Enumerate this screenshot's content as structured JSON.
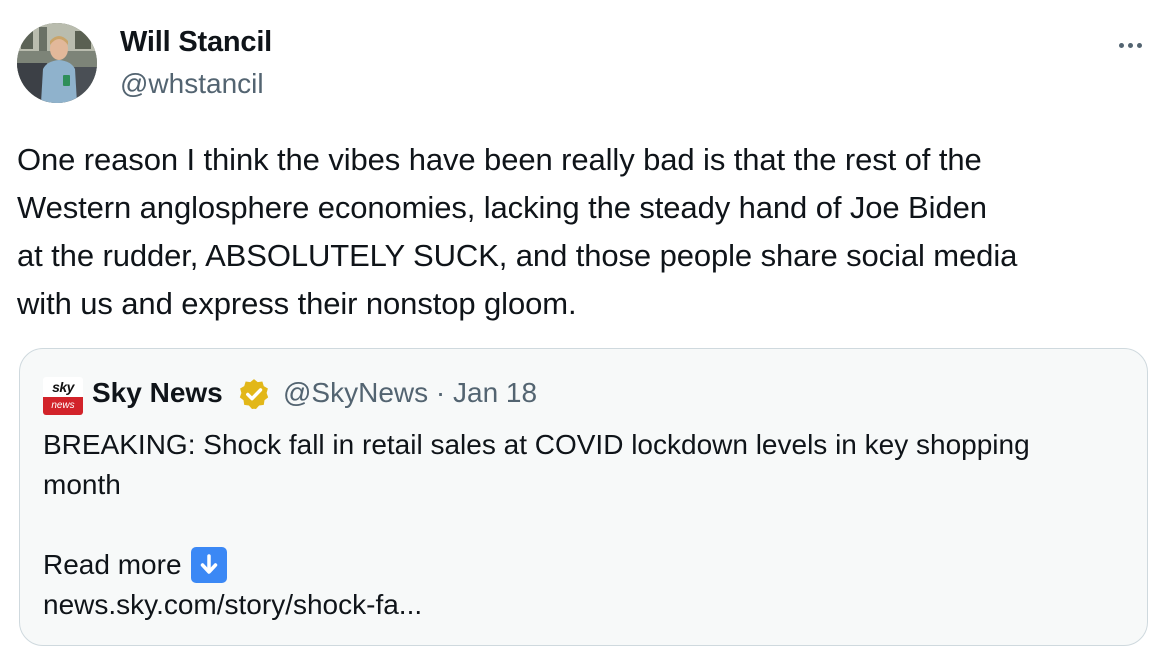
{
  "author": {
    "name": "Will Stancil",
    "handle": "@whstancil"
  },
  "tweet": {
    "text": "One reason I think the vibes have been really bad is that the rest of the\nWestern anglosphere economies, lacking the steady hand of Joe Biden\nat the rudder, ABSOLUTELY SUCK, and those people share social media\nwith us and express their nonstop gloom."
  },
  "more_icon": "more-horizontal-icon",
  "quoted": {
    "logo_top": "sky",
    "logo_bottom": "news",
    "name": "Sky News",
    "verified_icon": "gold-verified-badge-icon",
    "meta": "@SkyNews · Jan 18",
    "text": "BREAKING: Shock fall in retail sales at COVID lockdown levels in key shopping\nmonth",
    "read_more": "Read more",
    "read_more_icon": "down-arrow-emoji-icon",
    "link": "news.sky.com/story/shock-fa...",
    "colors": {
      "logo_red": "#d2232a",
      "badge_gold": "#e2b719",
      "arrow_blue": "#3b88f5"
    }
  }
}
